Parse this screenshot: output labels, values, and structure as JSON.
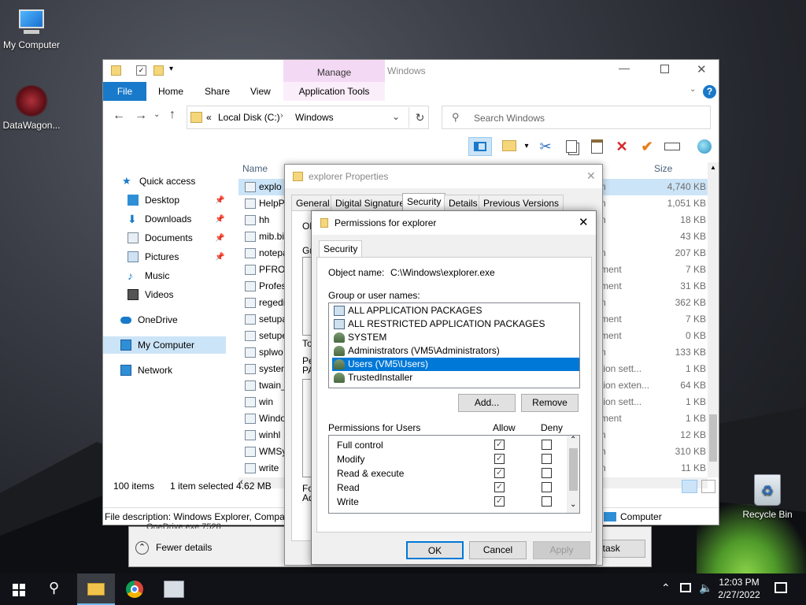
{
  "desktop": {
    "icons": [
      {
        "label": "My Computer"
      },
      {
        "label": "DataWagon..."
      },
      {
        "label": "Recycle Bin"
      }
    ]
  },
  "explorer": {
    "title": "Windows",
    "ribbon": {
      "manage": "Manage",
      "tabs": [
        "File",
        "Home",
        "Share",
        "View",
        "Application Tools"
      ]
    },
    "breadcrumb": {
      "prefix": "«",
      "items": [
        "Local Disk (C:)",
        "Windows"
      ]
    },
    "search_placeholder": "Search Windows",
    "nav": [
      "Quick access",
      "Desktop",
      "Downloads",
      "Documents",
      "Pictures",
      "Music",
      "Videos",
      "OneDrive",
      "My Computer",
      "Network"
    ],
    "columns": {
      "name": "Name",
      "size": "Size"
    },
    "files": [
      {
        "name": "explo",
        "type": "n",
        "size": "4,740 KB"
      },
      {
        "name": "HelpP",
        "type": "n",
        "size": "1,051 KB"
      },
      {
        "name": "hh",
        "type": "n",
        "size": "18 KB"
      },
      {
        "name": "mib.bi",
        "type": "",
        "size": "43 KB"
      },
      {
        "name": "notepa",
        "type": "n",
        "size": "207 KB"
      },
      {
        "name": "PFRO",
        "type": "ment",
        "size": "7 KB"
      },
      {
        "name": "Profes",
        "type": "ment",
        "size": "31 KB"
      },
      {
        "name": "regedi",
        "type": "n",
        "size": "362 KB"
      },
      {
        "name": "setupa",
        "type": "ment",
        "size": "7 KB"
      },
      {
        "name": "setupe",
        "type": "ment",
        "size": "0 KB"
      },
      {
        "name": "splwo",
        "type": "n",
        "size": "133 KB"
      },
      {
        "name": "system",
        "type": "tion sett...",
        "size": "1 KB"
      },
      {
        "name": "twain_",
        "type": "tion exten...",
        "size": "64 KB"
      },
      {
        "name": "win",
        "type": "tion sett...",
        "size": "1 KB"
      },
      {
        "name": "Windo",
        "type": "ment",
        "size": "1 KB"
      },
      {
        "name": "winhl",
        "type": "n",
        "size": "12 KB"
      },
      {
        "name": "WMSy",
        "type": "n",
        "size": "310 KB"
      },
      {
        "name": "write",
        "type": "n",
        "size": "11 KB"
      }
    ],
    "status": {
      "count": "100 items",
      "selected": "1 item selected  4.62 MB"
    },
    "description": "File description: Windows Explorer, Compan",
    "computer_label": "Computer"
  },
  "taskmanager": {
    "fewer": "Fewer details",
    "row": "OneDrive.exe     7528",
    "end_task": "nd task"
  },
  "properties": {
    "title": "explorer Properties",
    "tabs": [
      "General",
      "Digital Signatures",
      "Security",
      "Details",
      "Previous Versions"
    ],
    "frag": {
      "ob": "Ob",
      "gr": "Gr",
      "to": "To",
      "pe": "Pe",
      "pa": "PA",
      "for": "For",
      "ad": "Ad"
    }
  },
  "permissions": {
    "title": "Permissions for explorer",
    "tab": "Security",
    "object_label": "Object name:",
    "object_value": "C:\\Windows\\explorer.exe",
    "group_label": "Group or user names:",
    "users": [
      "ALL APPLICATION PACKAGES",
      "ALL RESTRICTED APPLICATION PACKAGES",
      "SYSTEM",
      "Administrators (VM5\\Administrators)",
      "Users (VM5\\Users)",
      "TrustedInstaller"
    ],
    "selected_user": 4,
    "add": "Add...",
    "remove": "Remove",
    "perm_label": "Permissions for Users",
    "allow": "Allow",
    "deny": "Deny",
    "perms": [
      {
        "name": "Full control",
        "allow": true,
        "deny": false
      },
      {
        "name": "Modify",
        "allow": true,
        "deny": false
      },
      {
        "name": "Read & execute",
        "allow": true,
        "deny": false
      },
      {
        "name": "Read",
        "allow": true,
        "deny": false
      },
      {
        "name": "Write",
        "allow": true,
        "deny": false
      }
    ],
    "ok": "OK",
    "cancel": "Cancel",
    "apply": "Apply"
  },
  "taskbar": {
    "time": "12:03 PM",
    "date": "2/27/2022"
  }
}
